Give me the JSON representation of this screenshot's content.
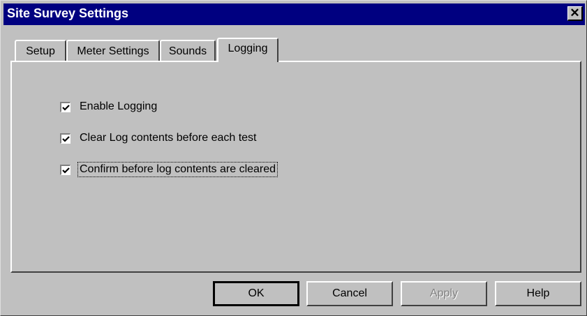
{
  "window": {
    "title": "Site Survey Settings",
    "close_glyph": "✕"
  },
  "tabs": [
    {
      "label": "Setup",
      "active": false
    },
    {
      "label": "Meter Settings",
      "active": false
    },
    {
      "label": "Sounds",
      "active": false
    },
    {
      "label": "Logging",
      "active": true
    }
  ],
  "logging": {
    "options": [
      {
        "label": "Enable Logging",
        "checked": true
      },
      {
        "label": "Clear Log contents before each test",
        "checked": true
      },
      {
        "label": "Confirm before log contents are cleared",
        "checked": true,
        "focused": true
      }
    ]
  },
  "buttons": {
    "ok": "OK",
    "cancel": "Cancel",
    "apply": "Apply",
    "apply_disabled": true,
    "help": "Help"
  },
  "colors": {
    "face": "#c0c0c0",
    "titlebar": "#000080",
    "disabled_text": "#808080"
  }
}
